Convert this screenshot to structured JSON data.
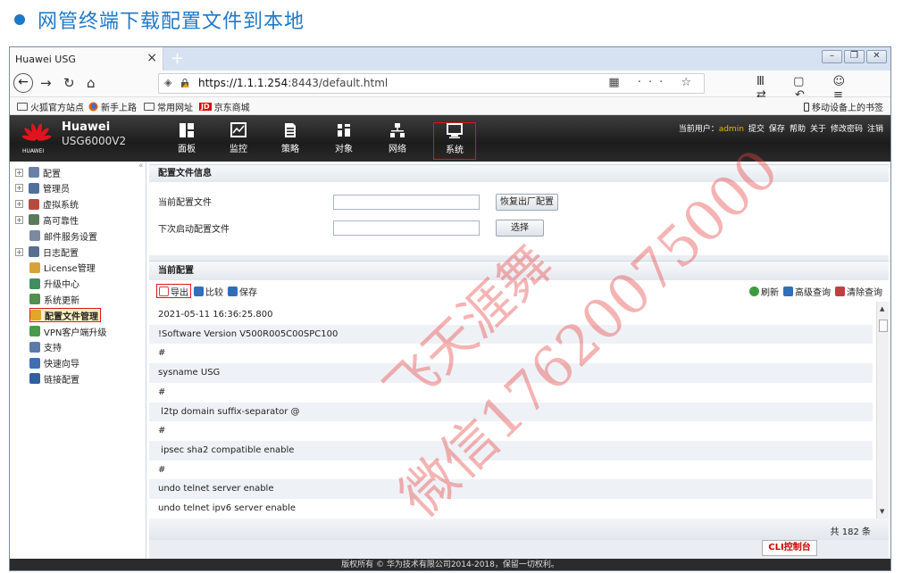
{
  "slide": {
    "title": "网管终端下载配置文件到本地"
  },
  "browser": {
    "tab_title": "Huawei USG",
    "tab_close": "×",
    "new_tab": "+",
    "url_host": "https://1.1.1.254",
    "url_path": ":8443/default.html",
    "url_right_icons": "▦ ··· ☆",
    "nav_right_icons": "Ⅲ ▢ ☺ ⇄ ↶ ≡",
    "bookmarks": [
      "火狐官方站点",
      "新手上路",
      "常用网址",
      "京东商城"
    ],
    "bookmark_jd_badge": "JD",
    "mobile_bookmarks": "移动设备上的书签"
  },
  "app": {
    "brand_line1": "Huawei",
    "brand_line2": "USG6000V2",
    "brand_small": "HUAWEI",
    "nav": [
      {
        "label": "面板",
        "icon": "dashboard-icon"
      },
      {
        "label": "监控",
        "icon": "monitor-icon"
      },
      {
        "label": "策略",
        "icon": "policy-icon"
      },
      {
        "label": "对象",
        "icon": "object-icon"
      },
      {
        "label": "网络",
        "icon": "network-icon"
      },
      {
        "label": "系统",
        "icon": "system-icon",
        "active": true
      }
    ],
    "header_links": {
      "current_user_label": "当前用户：",
      "current_user": "admin",
      "submit": "提交",
      "save": "保存",
      "help": "帮助",
      "about": "关于",
      "change_password": "修改密码",
      "logout": "注销"
    }
  },
  "sidebar": {
    "collapse": "«",
    "items": [
      {
        "label": "配置",
        "expandable": true,
        "color": "#6a7fa8"
      },
      {
        "label": "管理员",
        "expandable": true,
        "color": "#4f6f9c"
      },
      {
        "label": "虚拟系统",
        "expandable": true,
        "color": "#b84a3c"
      },
      {
        "label": "高可靠性",
        "expandable": true,
        "color": "#5a7a5a"
      },
      {
        "label": "邮件服务设置",
        "expandable": false,
        "color": "#7a8aa0"
      },
      {
        "label": "日志配置",
        "expandable": true,
        "color": "#5a6f90"
      },
      {
        "label": "License管理",
        "expandable": false,
        "color": "#d6a23c"
      },
      {
        "label": "升级中心",
        "expandable": false,
        "color": "#3f8f5f"
      },
      {
        "label": "系统更新",
        "expandable": false,
        "color": "#4f8f4f"
      },
      {
        "label": "配置文件管理",
        "expandable": false,
        "color": "#e3a62a",
        "active": true
      },
      {
        "label": "VPN客户端升级",
        "expandable": false,
        "color": "#4a9a4a"
      },
      {
        "label": "支持",
        "expandable": false,
        "color": "#5a7aa8"
      },
      {
        "label": "快速向导",
        "expandable": false,
        "color": "#3f6fb0"
      },
      {
        "label": "链接配置",
        "expandable": false,
        "color": "#2f5f9f"
      }
    ]
  },
  "config_info": {
    "title": "配置文件信息",
    "current_file_label": "当前配置文件",
    "current_file_value": "",
    "restore_button": "恢复出厂配置",
    "next_startup_label": "下次启动配置文件",
    "next_startup_value": "",
    "select_button": "选择"
  },
  "current_config": {
    "title": "当前配置",
    "toolbar": {
      "export": "导出",
      "compare": "比较",
      "save": "保存",
      "refresh": "刷新",
      "advanced_query": "高级查询",
      "clear_query": "清除查询"
    },
    "lines": [
      "2021-05-11 16:36:25.800",
      "!Software Version V500R005C00SPC100",
      "#",
      "sysname USG",
      "#",
      " l2tp domain suffix-separator @",
      "#",
      " ipsec sha2 compatible enable",
      "#",
      "undo telnet server enable",
      "undo telnet ipv6 server enable"
    ],
    "total": "共 182 条"
  },
  "cli_console": "CLI控制台",
  "copyright": "版权所有 © 华为技术有限公司2014-2018，保留一切权利。",
  "watermark": {
    "line1": "飞天涯舞",
    "line2": "微信17620075000"
  },
  "colors": {
    "accent": "#1e78c8",
    "highlight": "#e0141e",
    "watermark": "#e84040"
  }
}
